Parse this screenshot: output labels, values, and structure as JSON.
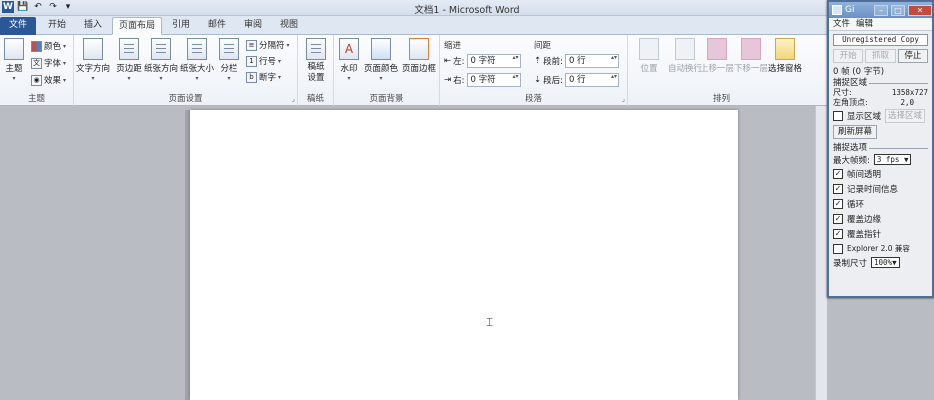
{
  "titlebar": {
    "title": "文档1 - Microsoft Word",
    "qat": [
      "W",
      "💾",
      "↶",
      "↷",
      "▾"
    ]
  },
  "tabs": [
    {
      "label": "文件"
    },
    {
      "label": "开始"
    },
    {
      "label": "插入"
    },
    {
      "label": "页面布局"
    },
    {
      "label": "引用"
    },
    {
      "label": "邮件"
    },
    {
      "label": "审阅"
    },
    {
      "label": "视图"
    }
  ],
  "ribbon": {
    "theme": {
      "label": "主题",
      "big": "主题",
      "items": [
        "颜色",
        "字体",
        "效果"
      ]
    },
    "page_setup": {
      "label": "页面设置",
      "buttons": [
        "文字方向",
        "页边距",
        "纸张方向",
        "纸张大小",
        "分栏"
      ],
      "small": [
        "分隔符",
        "行号",
        "断字"
      ]
    },
    "manuscript": {
      "label": "稿纸",
      "button": "稿纸设置"
    },
    "background": {
      "label": "页面背景",
      "buttons": [
        "水印",
        "页面颜色",
        "页面边框"
      ]
    },
    "paragraph": {
      "label": "段落",
      "indent_title": "缩进",
      "spacing_title": "间距",
      "left_label": "左:",
      "left_value": "0 字符",
      "right_label": "右:",
      "right_value": "0 字符",
      "before_label": "段前:",
      "before_value": "0 行",
      "after_label": "段后:",
      "after_value": "0 行"
    },
    "arrange": {
      "label": "排列",
      "buttons": [
        "位置",
        "自动换行",
        "上移一层",
        "下移一层",
        "选择窗格"
      ]
    }
  },
  "gifcam": {
    "title": "Gi",
    "menu": [
      "文件",
      "编辑"
    ],
    "status_box": "Unregistered Copy",
    "buttons": [
      "开始",
      "抓取",
      "停止"
    ],
    "frames": "0 帧 (0 字节)",
    "capture_area": {
      "title": "捕捉区域",
      "size_label": "尺寸:",
      "size_value": "1358x727",
      "origin_label": "左角顶点:",
      "origin_value": "2,0",
      "show_area": "显示区域",
      "select_area": "选择区域",
      "refresh": "刷新屏幕"
    },
    "capture_options": {
      "title": "捕捉选项",
      "max_fps_label": "最大帧频:",
      "max_fps_value": "3 fps ▼",
      "options": [
        {
          "label": "帧间透明",
          "checked": true
        },
        {
          "label": "记录时间信息",
          "checked": true
        },
        {
          "label": "循环",
          "checked": true
        },
        {
          "label": "覆盖边缘",
          "checked": true
        },
        {
          "label": "覆盖指针",
          "checked": true
        },
        {
          "label": "Explorer 2.0 兼容",
          "checked": false
        }
      ],
      "record_size_label": "录制尺寸",
      "record_size_value": "100%▼"
    }
  }
}
